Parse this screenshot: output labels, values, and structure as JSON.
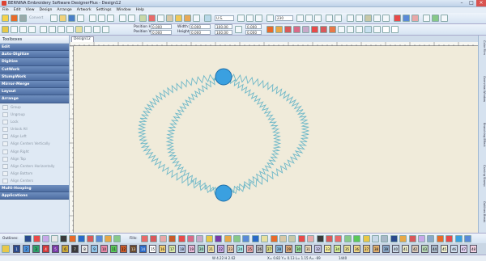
{
  "window": {
    "title": "BERNINA Embroidery Software DesignerPlus - Design12"
  },
  "menu": [
    "File",
    "Edit",
    "View",
    "Design",
    "Arrange",
    "Artwork",
    "Settings",
    "Window",
    "Help"
  ],
  "toolbar": {
    "convert_label": "Convert",
    "units": "U.S.",
    "zoom": "230",
    "position_h_label": "Position H:",
    "position_v_label": "Position V:",
    "width_label": "Width:",
    "height_label": "Height:",
    "pos_h": "0.000",
    "pos_v": "0.000",
    "width": "0.000",
    "height": "0.000",
    "pct_w": "100.00",
    "pct_h": "100.00",
    "angle_w": "0.000",
    "angle_h": "0.000"
  },
  "sidebar": {
    "header": "Toolboxes",
    "sections": [
      {
        "name": "Edit"
      },
      {
        "name": "Auto-Digitize"
      },
      {
        "name": "Digitize"
      },
      {
        "name": "CutWork"
      },
      {
        "name": "StumpWork"
      },
      {
        "name": "Mirror-Merge"
      },
      {
        "name": "Layout"
      },
      {
        "name": "Arrange"
      }
    ],
    "arrange_items": [
      "Group",
      "Ungroup",
      "Lock",
      "Unlock All",
      "Align Left",
      "Align Centers Vertically",
      "Align Right",
      "Align Top",
      "Align Centers Horizontally",
      "Align Bottom",
      "Align Centers"
    ],
    "footer_sections": [
      "Multi-Hooping",
      "Applications"
    ]
  },
  "document_tab": "Design12",
  "right_dock": [
    "Color Film",
    "Overview Window",
    "Branching Effect",
    "Carving Stamp",
    "Outlines Break"
  ],
  "bottom_toolbar": {
    "outlines_label": "Outlines:",
    "fills_label": "Fills:"
  },
  "palette": [
    {
      "num": "1",
      "color": "#2a4a8c"
    },
    {
      "num": "2",
      "color": "#4a8fd8"
    },
    {
      "num": "3",
      "color": "#2fa06a"
    },
    {
      "num": "4",
      "color": "#d63a3a"
    },
    {
      "num": "5",
      "color": "#7a3aa8"
    },
    {
      "num": "6",
      "color": "#c9a83a"
    },
    {
      "num": "7",
      "color": "#3a3a3a"
    },
    {
      "num": "8",
      "color": "#e6e6e6"
    },
    {
      "num": "9",
      "color": "#8fc4e8"
    },
    {
      "num": "10",
      "color": "#e88aa8"
    },
    {
      "num": "11",
      "color": "#5ac85a"
    },
    {
      "num": "12",
      "color": "#c85a2a"
    },
    {
      "num": "13",
      "color": "#6a4a2a"
    },
    {
      "num": "14",
      "color": "#2a6ac8"
    },
    {
      "num": "15",
      "color": "#ffffff"
    },
    {
      "num": "16",
      "color": "#f2d27a"
    },
    {
      "num": "17",
      "color": "#d8e8a8"
    },
    {
      "num": "18",
      "color": "#b8c8e8"
    },
    {
      "num": "19",
      "color": "#e8b8d8"
    },
    {
      "num": "20",
      "color": "#a8d8c8"
    },
    {
      "num": "21",
      "color": "#f0e0a0"
    },
    {
      "num": "22",
      "color": "#c8a8e8"
    },
    {
      "num": "23",
      "color": "#e8c8a8"
    },
    {
      "num": "24",
      "color": "#a8e8e8"
    },
    {
      "num": "25",
      "color": "#e8a8a8"
    },
    {
      "num": "26",
      "color": "#b8b8b8"
    },
    {
      "num": "27",
      "color": "#d8d888"
    },
    {
      "num": "28",
      "color": "#88b8d8"
    },
    {
      "num": "29",
      "color": "#d8a878"
    },
    {
      "num": "30",
      "color": "#98d898"
    },
    {
      "num": "31",
      "color": "#e8d8b8"
    },
    {
      "num": "32",
      "color": "#c8c8e8"
    },
    {
      "num": "33",
      "color": "#f8f0a0"
    },
    {
      "num": "34",
      "color": "#d8f098"
    },
    {
      "num": "35",
      "color": "#e8e098"
    },
    {
      "num": "36",
      "color": "#f0d888"
    },
    {
      "num": "37",
      "color": "#e8c878"
    },
    {
      "num": "38",
      "color": "#e0b070"
    },
    {
      "num": "39",
      "color": "#8aa8c8"
    },
    {
      "num": "40",
      "color": "#c8d8e8"
    },
    {
      "num": "41",
      "color": "#e8e8c8"
    },
    {
      "num": "42",
      "color": "#d8c8b8"
    },
    {
      "num": "43",
      "color": "#b8d8b8"
    },
    {
      "num": "44",
      "color": "#a8b8c8"
    },
    {
      "num": "45",
      "color": "#f0f0d0"
    },
    {
      "num": "46",
      "color": "#d0e0f0"
    },
    {
      "num": "47",
      "color": "#e0d0f0"
    },
    {
      "num": "48",
      "color": "#f0d0e0"
    }
  ],
  "status": {
    "wh": "W 4.22 H 2.62",
    "xy": "X= 0.82 Y= 0.13 L= 1.15 A= -69",
    "stitches": "1440"
  },
  "colors": {
    "thread": "#6fb8c8",
    "knot": "#3aa0e0",
    "canvas": "#f0ebda"
  }
}
